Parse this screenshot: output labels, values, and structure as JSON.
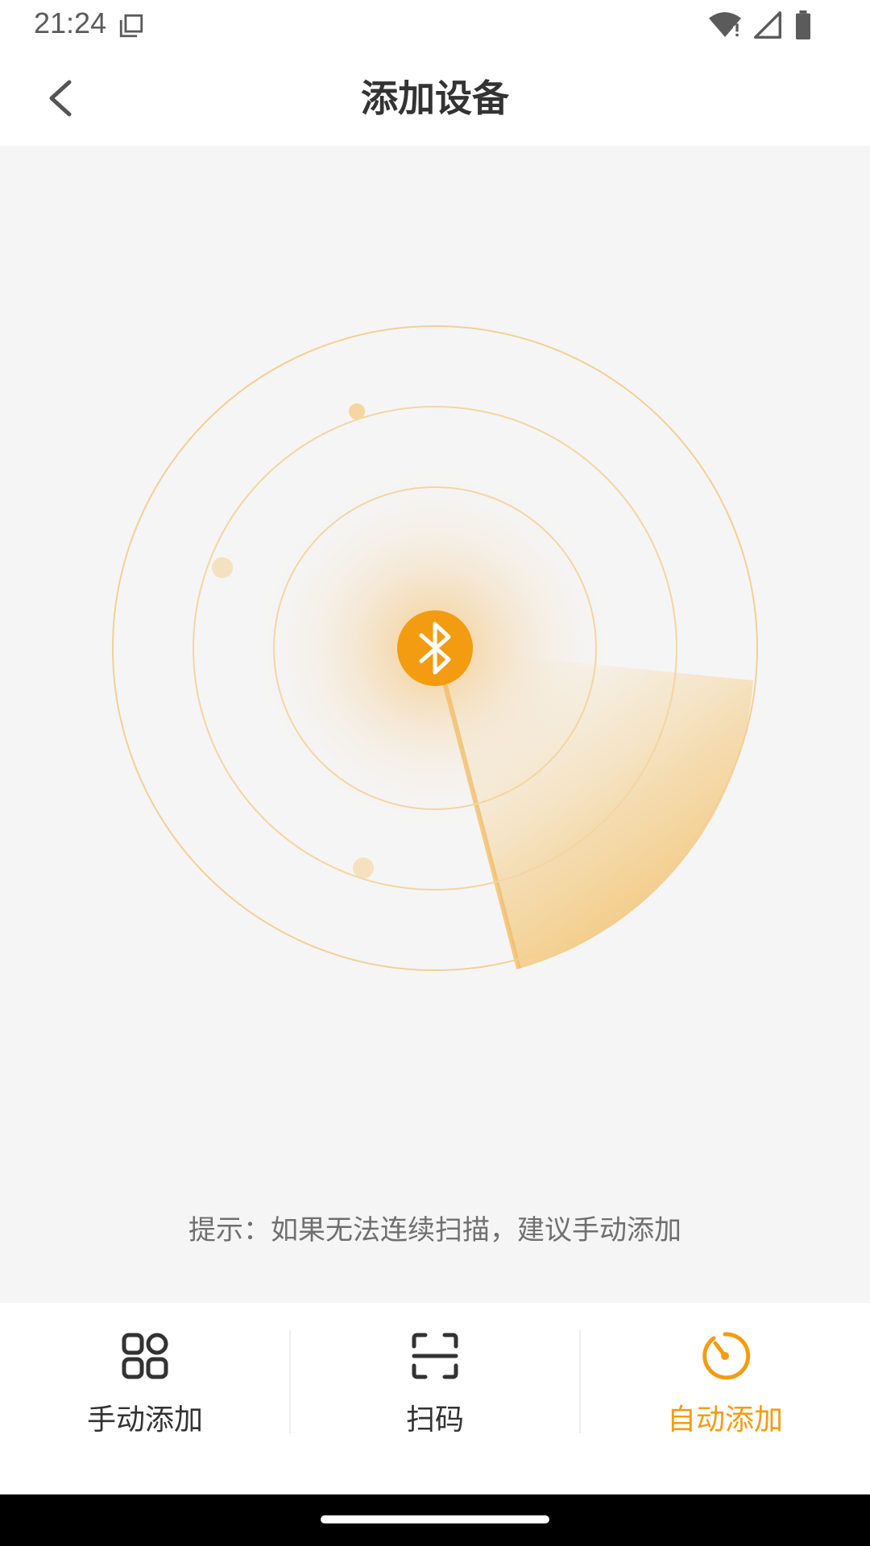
{
  "status_bar": {
    "time": "21:24",
    "icons": [
      "copy-icon",
      "wifi-icon",
      "signal-icon",
      "battery-icon"
    ]
  },
  "header": {
    "back_icon": "chevron-left-icon",
    "title": "添加设备"
  },
  "scanner": {
    "center_icon": "bluetooth-icon",
    "accent_color": "#f39c12"
  },
  "tip": "提示：如果无法连续扫描，建议手动添加",
  "bottom_nav": {
    "items": [
      {
        "label": "手动添加",
        "icon": "grid-icon",
        "active": false
      },
      {
        "label": "扫码",
        "icon": "scan-icon",
        "active": false
      },
      {
        "label": "自动添加",
        "icon": "auto-scan-icon",
        "active": true
      }
    ]
  },
  "colors": {
    "accent": "#f39c12",
    "text_primary": "#333333",
    "text_secondary": "#6f6f6f",
    "background": "#f5f5f5"
  }
}
